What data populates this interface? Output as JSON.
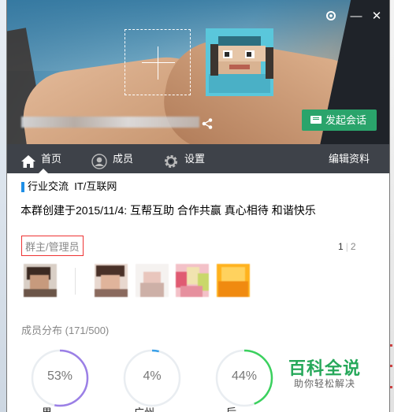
{
  "window": {
    "controls": {
      "settings_icon": "gear-icon",
      "minimize": "—",
      "close": "✕"
    }
  },
  "header": {
    "start_chat_label": "发起会话"
  },
  "tabs": [
    {
      "label": "首页",
      "icon": "home-icon",
      "active": true
    },
    {
      "label": "成员",
      "icon": "member-icon",
      "active": false
    },
    {
      "label": "设置",
      "icon": "gear-icon",
      "active": false
    }
  ],
  "edit_profile_label": "编辑资料",
  "group": {
    "tags": "行业交流  IT/互联网",
    "intro": "本群创建于2015/11/4:  互帮互助  合作共赢  真心相待  和谐快乐"
  },
  "admins": {
    "label": "群主/管理员",
    "pages": [
      "1",
      "2"
    ],
    "current_page": "1"
  },
  "distribution": {
    "label": "成员分布 (171/500)",
    "rings": [
      {
        "percent_label": "53%",
        "value": 53,
        "color": "#9b7fe6",
        "caption": "男"
      },
      {
        "percent_label": "4%",
        "value": 4,
        "color": "#3aa0e8",
        "caption": "广州"
      },
      {
        "percent_label": "44%",
        "value": 44,
        "color": "#3bd15e",
        "caption": "后"
      }
    ],
    "track_color": "#e9edf1"
  },
  "watermark": {
    "title": "百科全说",
    "subtitle": "助你轻松解决"
  },
  "colors": {
    "accent_green": "#2aa46b",
    "tab_bar": "#23282f",
    "tag_bar_blue": "#1f8fe6",
    "highlight_red": "#e33333"
  }
}
